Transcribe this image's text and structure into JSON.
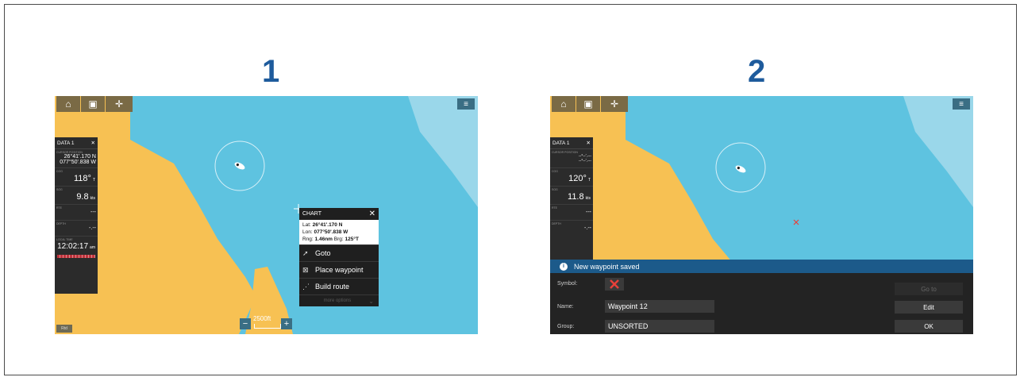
{
  "steps": [
    {
      "number": "1"
    },
    {
      "number": "2"
    }
  ],
  "colors": {
    "sea": "#5ec3e0",
    "land": "#f7c153",
    "deep_sea": "#9ad7ea",
    "accent": "#1e5b9c",
    "banner": "#1c5a8a"
  },
  "toolbar": {
    "home_icon": "home-icon",
    "chart_icon": "chart-waypoint-icon",
    "cross_icon": "crosshair-icon",
    "menu_icon": "menu-icon"
  },
  "screen1": {
    "data_panel": {
      "title": "DATA 1",
      "close": "✕",
      "position_label": "CURSOR POSITION",
      "lat": "26°41'.170 N",
      "lon": "077°50'.838 W",
      "cog_label": "COG",
      "cog_value": "118°",
      "cog_unit": "T",
      "sog_label": "SOG",
      "sog_value": "9.8",
      "sog_unit": "kts",
      "rte_label": "RTE",
      "rte_value": "---",
      "depth_label": "DEPTH",
      "depth_value": "-.--",
      "time_label": "LOCAL TIME",
      "time_value": "12:02:17",
      "time_unit": "am"
    },
    "chart_popup": {
      "title": "CHART",
      "close": "✕",
      "lat_label": "Lat:",
      "lat_value": "26°41'.170 N",
      "lon_label": "Lon:",
      "lon_value": "077°50'.838 W",
      "rng_label": "Rng:",
      "rng_value": "1.46nm",
      "brg_label": "Brg:",
      "brg_value": "125°T",
      "items": [
        {
          "label": "Goto",
          "icon": "goto-icon"
        },
        {
          "label": "Place waypoint",
          "icon": "place-waypoint-icon"
        },
        {
          "label": "Build route",
          "icon": "build-route-icon"
        }
      ],
      "more_label": "more options"
    },
    "zoom": {
      "minus": "−",
      "plus": "+",
      "scale": "2500ft"
    },
    "corner_label": "Rtd"
  },
  "screen2": {
    "data_panel": {
      "title": "DATA 1",
      "close": "✕",
      "position_label": "CURSOR POSITION",
      "lat": "--°--'.---",
      "lon": "--°--'.---",
      "cog_label": "COG",
      "cog_value": "120°",
      "cog_unit": "T",
      "sog_label": "SOG",
      "sog_value": "11.8",
      "sog_unit": "kts",
      "rte_label": "RTE",
      "rte_value": "---",
      "depth_label": "DEPTH",
      "depth_value": "-.--"
    },
    "banner": {
      "icon": "i",
      "text": "New waypoint saved"
    },
    "waypoint": {
      "symbol_label": "Symbol:",
      "name_label": "Name:",
      "name_value": "Waypoint 12",
      "group_label": "Group:",
      "group_value": "UNSORTED",
      "goto_label": "Go to",
      "edit_label": "Edit",
      "ok_label": "OK"
    }
  }
}
